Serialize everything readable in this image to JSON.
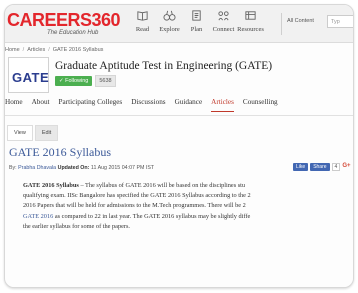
{
  "header": {
    "logo_text": "CAREERS360",
    "logo_tagline": "The Education Hub",
    "nav": [
      {
        "label": "Read",
        "icon": "book-icon"
      },
      {
        "label": "Explore",
        "icon": "binoculars-icon"
      },
      {
        "label": "Plan",
        "icon": "plan-icon"
      },
      {
        "label": "Connect",
        "icon": "connect-icon"
      },
      {
        "label": "Resources",
        "icon": "resources-icon"
      }
    ],
    "all_content": "All Content",
    "search_placeholder": "Typ"
  },
  "breadcrumb": [
    "Home",
    "Articles",
    "GATE 2016 Syllabus"
  ],
  "exam": {
    "logo": "GATE",
    "title": "Graduate Aptitude Test in Engineering (GATE)",
    "follow_label": "✓ Following",
    "follow_count": "5638"
  },
  "tabs": [
    "Home",
    "About",
    "Participating Colleges",
    "Discussions",
    "Guidance",
    "Articles",
    "Counselling"
  ],
  "active_tab": "Articles",
  "view_label": "View",
  "edit_label": "Edit",
  "article": {
    "title": "GATE 2016 Syllabus",
    "by_prefix": "By:",
    "author": "Prabha Dhavala",
    "updated_label": "Updated On:",
    "updated_date": "11 Aug 2015 04:07 PM IST",
    "share": {
      "like": "Like",
      "share": "Share",
      "count": "4",
      "gplus": "G+"
    },
    "lines": [
      {
        "lead": "GATE 2016 Syllabus",
        "text": " – The syllabus of GATE 2016 will be based on the disciplines stu"
      },
      {
        "text": "qualifying exam. IISc Bangalore has specified the GATE 2016 Syllabus according to the 2"
      },
      {
        "text": "2016 Papers that will be held for admissions to the M.Tech programmes. There will be 2"
      },
      {
        "link": "GATE 2016",
        "text": " as compared to 22 in last year. The GATE 2016 syllabus may be slightly diffe"
      },
      {
        "text": "the earlier syllabus for some of the papers."
      }
    ]
  }
}
